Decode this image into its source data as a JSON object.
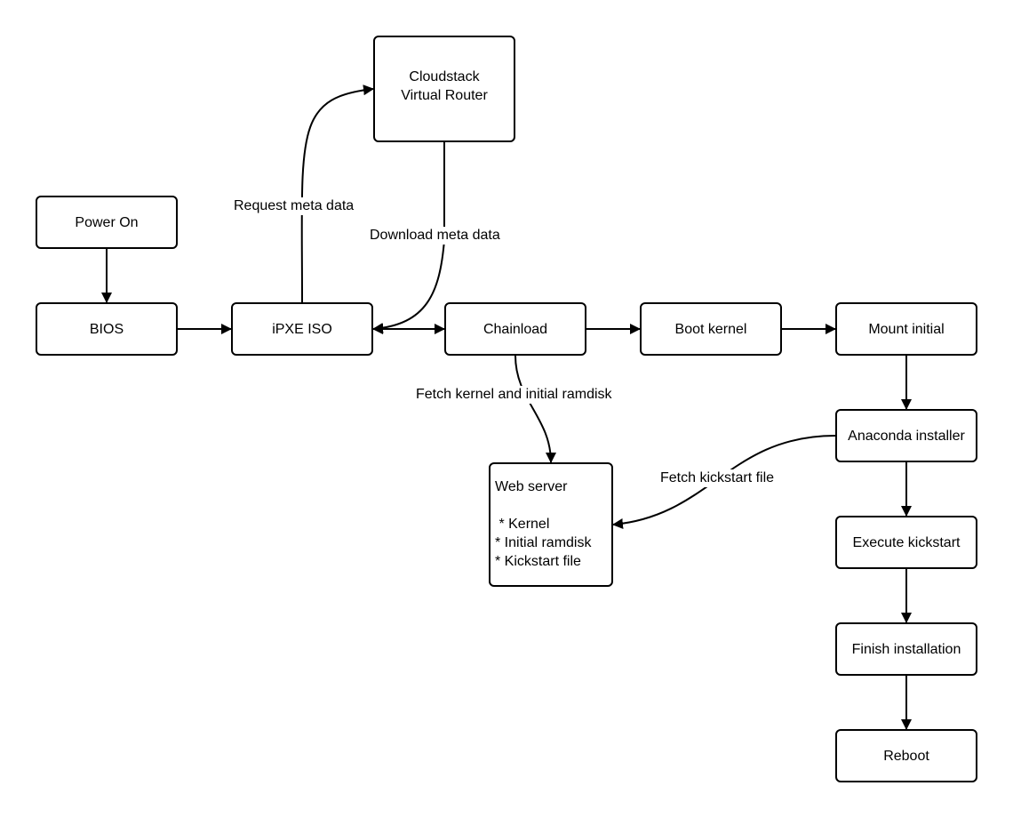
{
  "diagram": {
    "nodes": {
      "power_on": {
        "label": "Power On"
      },
      "bios": {
        "label": "BIOS"
      },
      "ipxe_iso": {
        "label": "iPXE ISO"
      },
      "cloudstack": {
        "line1": "Cloudstack",
        "line2": "Virtual Router"
      },
      "chainload": {
        "label": "Chainload"
      },
      "boot_kernel": {
        "label": "Boot kernel"
      },
      "mount_initial": {
        "label": "Mount initial"
      },
      "anaconda": {
        "label": "Anaconda installer"
      },
      "execute_kickstart": {
        "label": "Execute kickstart"
      },
      "finish_installation": {
        "label": "Finish installation"
      },
      "reboot": {
        "label": "Reboot"
      },
      "web_server": {
        "title": "Web server",
        "items": [
          " * Kernel",
          "* Initial ramdisk",
          "* Kickstart file"
        ]
      }
    },
    "edge_labels": {
      "request_meta": "Request meta data",
      "download_meta": "Download meta data",
      "fetch_kernel": "Fetch kernel and initial ramdisk",
      "fetch_kickstart": "Fetch kickstart file"
    }
  }
}
